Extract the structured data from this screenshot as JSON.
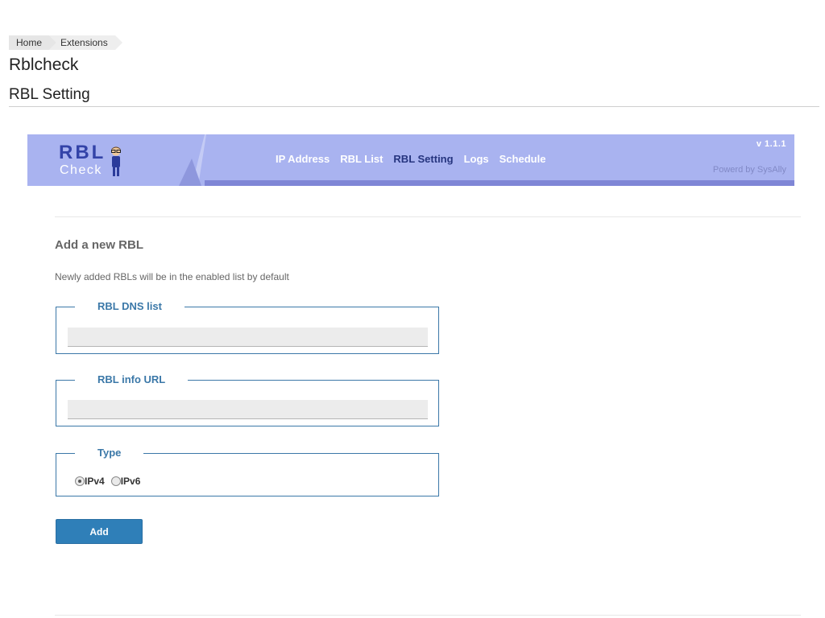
{
  "breadcrumb": {
    "items": [
      {
        "label": "Home"
      },
      {
        "label": "Extensions"
      }
    ]
  },
  "page": {
    "title": "Rblcheck",
    "section_title": "RBL Setting"
  },
  "banner": {
    "logo_top": "RBL",
    "logo_bottom": "Check",
    "nav": [
      {
        "label": "IP Address",
        "active": false
      },
      {
        "label": "RBL List",
        "active": false
      },
      {
        "label": "RBL Setting",
        "active": true
      },
      {
        "label": "Logs",
        "active": false
      },
      {
        "label": "Schedule",
        "active": false
      }
    ],
    "version": "v 1.1.1",
    "powered_by": "Powerd by SysAlly",
    "colors": {
      "background": "#a9b3f0",
      "bottom_bar": "#7f86d6",
      "active_nav": "#26357f"
    }
  },
  "form": {
    "heading": "Add a new RBL",
    "hint": "Newly added RBLs will be in the enabled list by default",
    "dns_legend": "RBL DNS list",
    "dns_value": "",
    "url_legend": "RBL info URL",
    "url_value": "",
    "type_legend": "Type",
    "type_options": [
      {
        "label": "IPv4",
        "checked": true
      },
      {
        "label": "IPv6",
        "checked": false
      }
    ],
    "add_label": "Add",
    "accent_color": "#2f7fb8"
  },
  "icons": {
    "logo_figure": "person-with-glasses-icon",
    "radio": "radio-button-icon"
  }
}
